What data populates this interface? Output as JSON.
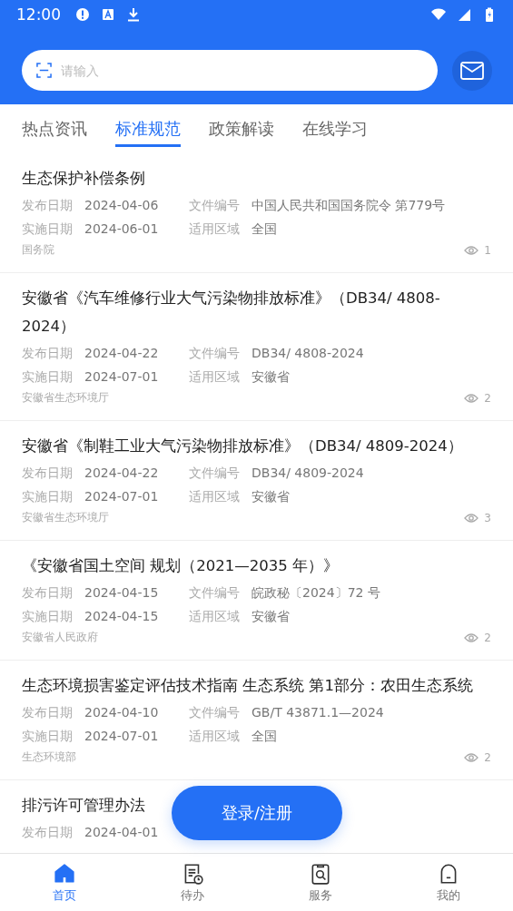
{
  "status_bar": {
    "time": "12:00"
  },
  "search": {
    "placeholder": "请输入"
  },
  "tabs": [
    {
      "label": "热点资讯",
      "selected": false
    },
    {
      "label": "标准规范",
      "selected": true
    },
    {
      "label": "政策解读",
      "selected": false
    },
    {
      "label": "在线学习",
      "selected": false
    }
  ],
  "items": [
    {
      "title": "生态保护补偿条例",
      "fields": [
        {
          "label": "发布日期",
          "value": "2024-04-06"
        },
        {
          "label": "文件编号",
          "value": "中国人民共和国国务院令 第779号"
        },
        {
          "label": "实施日期",
          "value": "2024-06-01"
        },
        {
          "label": "适用区域",
          "value": "全国"
        }
      ],
      "source": "国务院",
      "views": "1"
    },
    {
      "title": "安徽省《汽车维修行业大气污染物排放标准》（DB34/ 4808-2024）",
      "fields": [
        {
          "label": "发布日期",
          "value": "2024-04-22"
        },
        {
          "label": "文件编号",
          "value": "DB34/ 4808-2024"
        },
        {
          "label": "实施日期",
          "value": "2024-07-01"
        },
        {
          "label": "适用区域",
          "value": "安徽省"
        }
      ],
      "source": "安徽省生态环境厅",
      "views": "2"
    },
    {
      "title": "安徽省《制鞋工业大气污染物排放标准》（DB34/ 4809-2024）",
      "fields": [
        {
          "label": "发布日期",
          "value": "2024-04-22"
        },
        {
          "label": "文件编号",
          "value": "DB34/ 4809-2024"
        },
        {
          "label": "实施日期",
          "value": "2024-07-01"
        },
        {
          "label": "适用区域",
          "value": "安徽省"
        }
      ],
      "source": "安徽省生态环境厅",
      "views": "3"
    },
    {
      "title": "《安徽省国土空间 规划（2021—2035 年）》",
      "fields": [
        {
          "label": "发布日期",
          "value": "2024-04-15"
        },
        {
          "label": "文件编号",
          "value": "皖政秘〔2024〕72 号"
        },
        {
          "label": "实施日期",
          "value": "2024-04-15"
        },
        {
          "label": "适用区域",
          "value": "安徽省"
        }
      ],
      "source": "安徽省人民政府",
      "views": "2"
    },
    {
      "title": "生态环境损害鉴定评估技术指南 生态系统 第1部分：农田生态系统",
      "fields": [
        {
          "label": "发布日期",
          "value": "2024-04-10"
        },
        {
          "label": "文件编号",
          "value": "GB/T 43871.1—2024"
        },
        {
          "label": "实施日期",
          "value": "2024-07-01"
        },
        {
          "label": "适用区域",
          "value": "全国"
        }
      ],
      "source": "生态环境部",
      "views": "2"
    },
    {
      "title": "排污许可管理办法",
      "fields": [
        {
          "label": "发布日期",
          "value": "2024-04-01"
        }
      ]
    }
  ],
  "login_button": "登录/注册",
  "nav": [
    {
      "kind": "home",
      "label": "首页",
      "selected": true
    },
    {
      "kind": "todo",
      "label": "待办",
      "selected": false
    },
    {
      "kind": "service",
      "label": "服务",
      "selected": false
    },
    {
      "kind": "mine",
      "label": "我的",
      "selected": false
    }
  ]
}
